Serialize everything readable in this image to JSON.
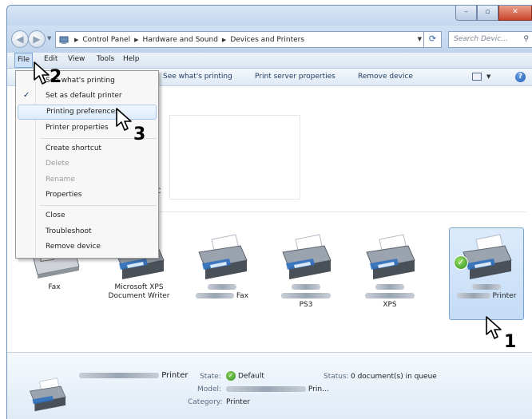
{
  "window": {
    "min_label": "–",
    "max_label": "▫",
    "close_label": "✕"
  },
  "address": {
    "crumbs": [
      "Control Panel",
      "Hardware and Sound",
      "Devices and Printers"
    ],
    "search_placeholder": "Search Devic..."
  },
  "menubar": {
    "file": "File",
    "edit": "Edit",
    "view": "View",
    "tools": "Tools",
    "help": "Help"
  },
  "commandbar": {
    "see_printing": "See what's printing",
    "server_props": "Print server properties",
    "remove_device": "Remove device"
  },
  "file_menu": {
    "items": [
      {
        "label": "See what's printing"
      },
      {
        "label": "Set as default printer",
        "checked": true
      },
      {
        "label": "Printing preferences",
        "highlighted": true
      },
      {
        "label": "Printer properties"
      },
      {
        "label": "Create shortcut"
      },
      {
        "label": "Delete",
        "disabled": true
      },
      {
        "label": "Rename",
        "disabled": true
      },
      {
        "label": "Properties"
      },
      {
        "label": "Close"
      },
      {
        "label": "Troubleshoot"
      },
      {
        "label": "Remove device"
      }
    ]
  },
  "content": {
    "partial_text": "C"
  },
  "printers": [
    {
      "label": "Fax"
    },
    {
      "label": "Microsoft XPS",
      "label2": "Document Writer"
    },
    {
      "label": "Fax"
    },
    {
      "label": "PS3"
    },
    {
      "label": "XPS"
    },
    {
      "label": "Printer",
      "selected": true,
      "default": true
    }
  ],
  "details": {
    "name": "Printer",
    "state_label": "State:",
    "state_value": "Default",
    "status_label": "Status:",
    "status_value": "0 document(s) in queue",
    "model_label": "Model:",
    "model_value": "Prin...",
    "category_label": "Category:",
    "category_value": "Printer"
  },
  "steps": {
    "one": "1",
    "two": "2",
    "three": "3"
  },
  "colors": {
    "accent": "#3265a8",
    "selection": "#c5dcf6",
    "default_badge": "#2f8f1c"
  }
}
